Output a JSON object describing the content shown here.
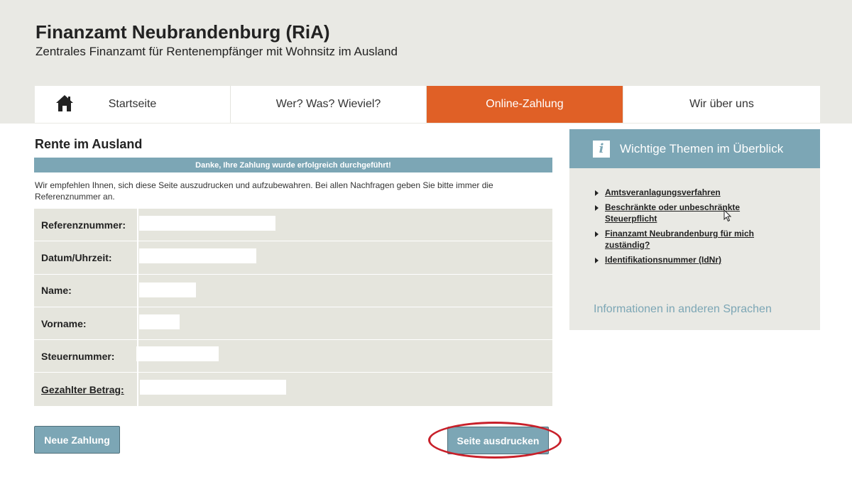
{
  "header": {
    "title": "Finanzamt Neubrandenburg (RiA)",
    "subtitle": "Zentrales Finanzamt für Rentenempfänger mit Wohnsitz im Ausland"
  },
  "nav": {
    "items": [
      {
        "label": "Startseite",
        "icon": "home-icon"
      },
      {
        "label": "Wer? Was? Wieviel?"
      },
      {
        "label": "Online-Zahlung",
        "active": true
      },
      {
        "label": "Wir über uns"
      }
    ],
    "active_color": "#e06026"
  },
  "main": {
    "title": "Rente im Ausland",
    "success_message": "Danke, Ihre Zahlung wurde erfolgreich durchgeführt!",
    "info_text": "Wir empfehlen Ihnen, sich diese Seite auszudrucken und aufzubewahren. Bei allen Nachfragen geben Sie bitte immer die Referenznummer an.",
    "rows": [
      {
        "label": "Referenznummer:",
        "value": ""
      },
      {
        "label": "Datum/Uhrzeit:",
        "value": ""
      },
      {
        "label": "Name:",
        "value": ""
      },
      {
        "label": "Vorname:",
        "value": ""
      },
      {
        "label": "Steuernummer:",
        "value": ""
      },
      {
        "label": "Gezahlter Betrag:",
        "value": ""
      }
    ],
    "buttons": {
      "new_payment": "Neue Zahlung",
      "print_page": "Seite ausdrucken"
    }
  },
  "sidebar": {
    "heading": "Wichtige Themen im Überblick",
    "icon": "info-icon",
    "topics": [
      "Amtsveranlagungsverfahren",
      "Beschränkte oder unbeschränkte Steuerpflicht",
      "Finanzamt Neubrandenburg für mich zuständig?",
      "Identifikationsnummer (IdNr)"
    ],
    "other_languages": "Informationen in anderen Sprachen"
  },
  "colors": {
    "accent": "#7ca6b5",
    "header_bg": "#e9e9e4",
    "table_bg": "#e5e5dd",
    "highlight": "#c8202a"
  }
}
